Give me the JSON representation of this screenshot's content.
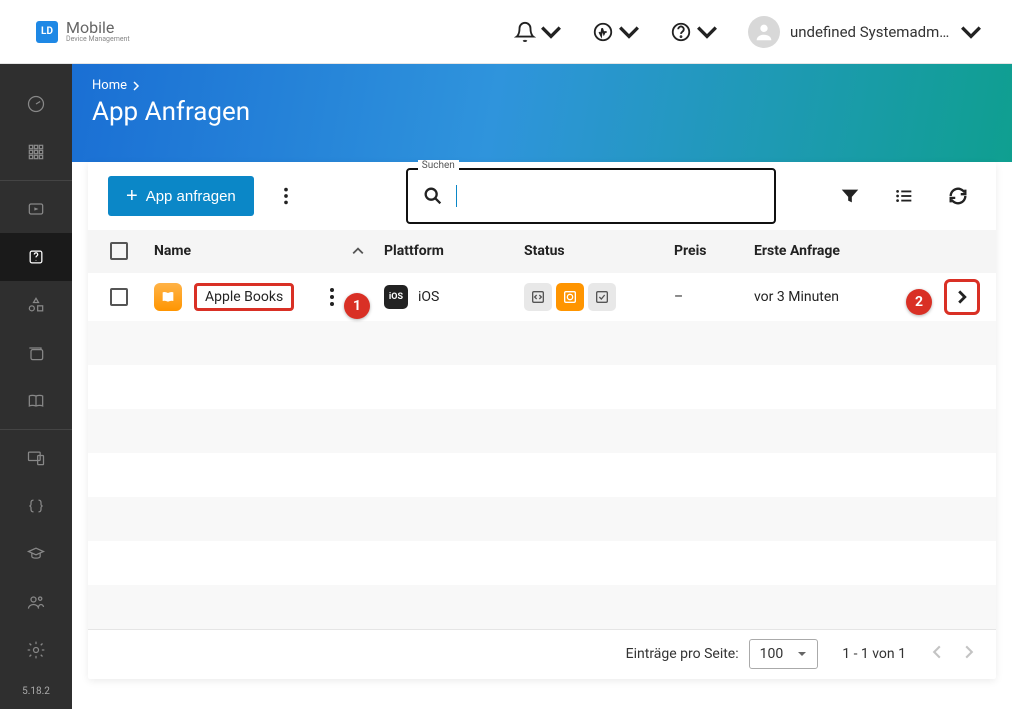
{
  "brand": {
    "short": "LD",
    "name": "Mobile",
    "sub": "Device Management"
  },
  "header": {
    "username": "undefined Systemadmi..."
  },
  "sidebar": {
    "version": "5.18.2"
  },
  "breadcrumb": {
    "home": "Home"
  },
  "page": {
    "title": "App Anfragen"
  },
  "toolbar": {
    "request_btn": "App anfragen",
    "search_label": "Suchen",
    "search_value": ""
  },
  "table": {
    "columns": {
      "name": "Name",
      "platform": "Plattform",
      "status": "Status",
      "price": "Preis",
      "first_request": "Erste Anfrage"
    },
    "rows": [
      {
        "name": "Apple Books",
        "platform_code": "iOS",
        "platform": "iOS",
        "price": "–",
        "first_request": "vor 3 Minuten"
      }
    ]
  },
  "pagination": {
    "per_page_label": "Einträge pro Seite:",
    "per_page_value": "100",
    "range": "1 - 1 von 1"
  },
  "callouts": {
    "one": "1",
    "two": "2"
  }
}
